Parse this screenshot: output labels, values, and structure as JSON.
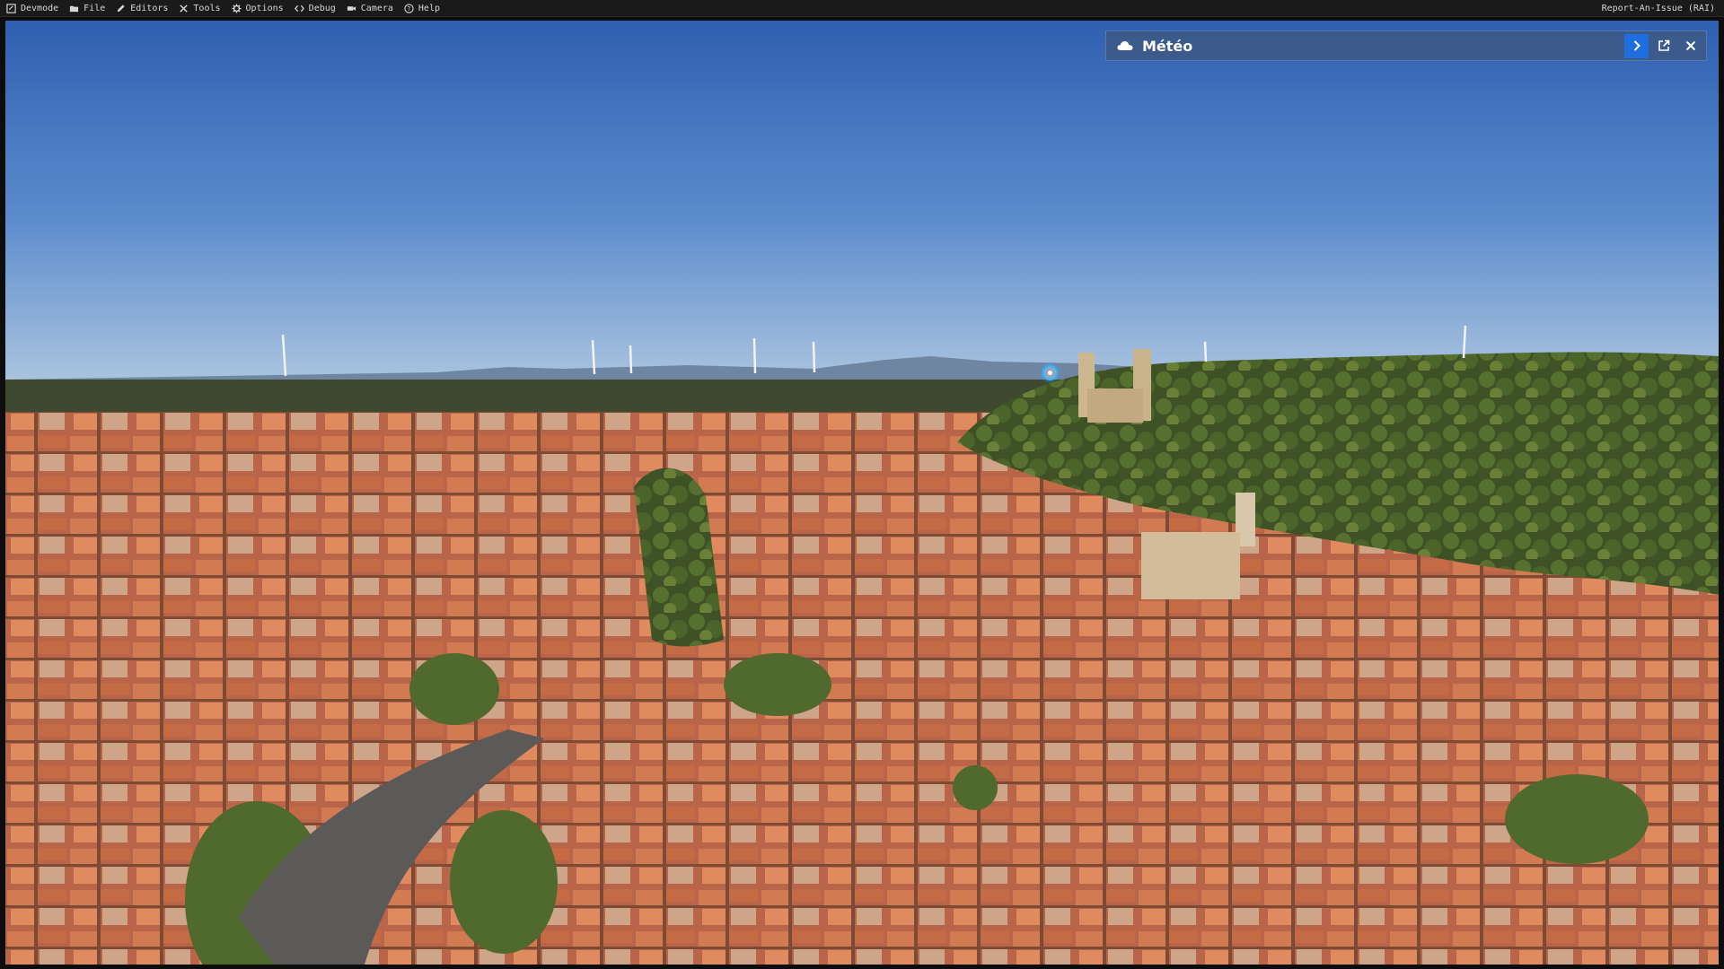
{
  "menubar": {
    "items": [
      {
        "label": "Devmode",
        "icon": "devmode-icon"
      },
      {
        "label": "File",
        "icon": "folder-icon"
      },
      {
        "label": "Editors",
        "icon": "pencil-icon"
      },
      {
        "label": "Tools",
        "icon": "tools-icon"
      },
      {
        "label": "Options",
        "icon": "gear-icon"
      },
      {
        "label": "Debug",
        "icon": "code-icon"
      },
      {
        "label": "Camera",
        "icon": "camera-icon"
      },
      {
        "label": "Help",
        "icon": "help-icon"
      }
    ],
    "report_link": "Report-An-Issue (RAI)"
  },
  "weather_panel": {
    "title": "Météo",
    "icon": "cloud-icon",
    "buttons": [
      "expand-arrow-icon",
      "popout-icon",
      "close-icon"
    ],
    "accent_color": "#1d6fe0"
  },
  "scene": {
    "description_icons": [
      "poi-marker-icon"
    ],
    "sky_top_color": "#2f5fb0",
    "horizon_color": "#a9c3de",
    "roof_color": "#c8643c"
  }
}
